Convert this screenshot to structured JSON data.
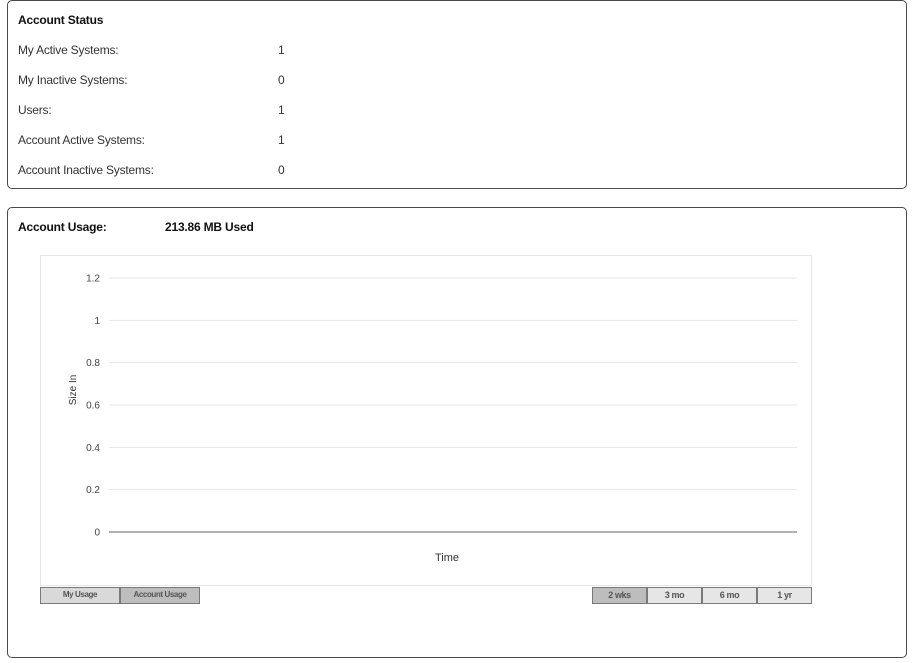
{
  "account_status": {
    "title": "Account Status",
    "rows": [
      {
        "label": "My Active Systems:",
        "value": "1"
      },
      {
        "label": "My Inactive Systems:",
        "value": "0"
      },
      {
        "label": "Users:",
        "value": "1"
      },
      {
        "label": "Account Active Systems:",
        "value": "1"
      },
      {
        "label": "Account Inactive Systems:",
        "value": "0"
      }
    ]
  },
  "account_usage": {
    "label": "Account Usage:",
    "value": "213.86 MB  Used"
  },
  "chart_data": {
    "type": "line",
    "xlabel": "Time",
    "ylabel": "Size In",
    "ylim": [
      0,
      1.2
    ],
    "yticks": [
      "0",
      "0.2",
      "0.4",
      "0.6",
      "0.8",
      "1",
      "1.2"
    ],
    "series": [],
    "grid": true
  },
  "view_buttons": [
    {
      "label": "My Usage",
      "active": false
    },
    {
      "label": "Account Usage",
      "active": true
    }
  ],
  "range_buttons": [
    {
      "label": "2 wks",
      "active": true
    },
    {
      "label": "3 mo",
      "active": false
    },
    {
      "label": "6 mo",
      "active": false
    },
    {
      "label": "1 yr",
      "active": false
    }
  ],
  "colors": {
    "border": "#4a4a4a",
    "gridline": "#e6e6e6",
    "axis": "#666666",
    "button_bg": "#d9d9d9",
    "button_active_bg": "#bdbdbd"
  }
}
